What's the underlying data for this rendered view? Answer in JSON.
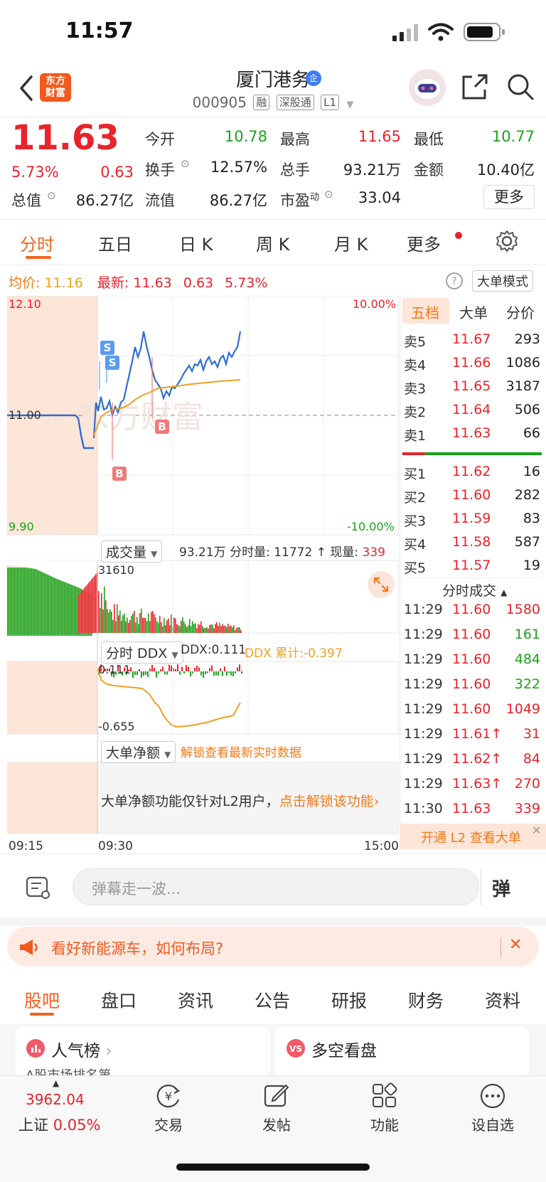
{
  "status": {
    "time": "11:57"
  },
  "header": {
    "brand_line1": "东方",
    "brand_line2": "财富",
    "stock_name": "厦门港务",
    "badge": "企",
    "code": "000905",
    "tags": [
      "融",
      "深股通",
      "L1"
    ]
  },
  "quote": {
    "price": "11.63",
    "change_pct": "5.73%",
    "change_amt": "0.63",
    "total_value_label": "总值",
    "total_value": "86.27亿",
    "open_label": "今开",
    "open": "10.78",
    "high_label": "最高",
    "high": "11.65",
    "low_label": "最低",
    "low": "10.77",
    "turnover_label": "换手",
    "turnover": "12.57%",
    "volume_label": "总手",
    "volume": "93.21万",
    "amount_label": "金额",
    "amount": "10.40亿",
    "float_label": "流值",
    "float_value": "86.27亿",
    "pe_label": "市盈",
    "pe_sup": "动",
    "pe": "33.04",
    "more_button": "更多"
  },
  "chart_tabs": [
    "分时",
    "五日",
    "日 K",
    "周 K",
    "月 K",
    "更多"
  ],
  "info_line": {
    "avg_label": "均价:",
    "avg": "11.16",
    "latest_label": "最新:",
    "latest": "11.63",
    "chg": "0.63",
    "pct": "5.73%",
    "mode_button": "大单模式"
  },
  "chart_labels": {
    "price_top": "12.10",
    "price_mid": "11.00",
    "price_bottom": "9.90",
    "pct_top": "10.00%",
    "pct_bottom": "-10.00%",
    "volume_selector": "成交量",
    "volume_total": "93.21万",
    "volume_period_label": "分时量:",
    "volume_period": "11772",
    "volume_now_label": "现量:",
    "volume_now": "339",
    "volume_axis": "31610",
    "ddx_selector": "分时 DDX",
    "ddx_text": "DDX:0.111",
    "ddx_sum": "DDX 累计:-0.397",
    "ddx_top": "0.111",
    "ddx_bottom": "-0.655",
    "bignet_selector": "大单净额",
    "bignet_unlock": "解锁查看最新实时数据",
    "bignet_notice": "大单净额功能仅针对L2用户，",
    "bignet_link": "点击解锁该功能",
    "time_start": "09:15",
    "time_open": "09:30",
    "time_end": "15:00",
    "marker_s": "S",
    "marker_b": "B"
  },
  "side_tabs": [
    "五档",
    "大单",
    "分价"
  ],
  "asks": [
    {
      "label": "卖5",
      "price": "11.67",
      "vol": "293"
    },
    {
      "label": "卖4",
      "price": "11.66",
      "vol": "1086"
    },
    {
      "label": "卖3",
      "price": "11.65",
      "vol": "3187"
    },
    {
      "label": "卖2",
      "price": "11.64",
      "vol": "506"
    },
    {
      "label": "卖1",
      "price": "11.63",
      "vol": "66"
    }
  ],
  "bids": [
    {
      "label": "买1",
      "price": "11.62",
      "vol": "16"
    },
    {
      "label": "买2",
      "price": "11.60",
      "vol": "282"
    },
    {
      "label": "买3",
      "price": "11.59",
      "vol": "83"
    },
    {
      "label": "买4",
      "price": "11.58",
      "vol": "587"
    },
    {
      "label": "买5",
      "price": "11.57",
      "vol": "19"
    }
  ],
  "ticks_title": "分时成交",
  "ticks": [
    {
      "time": "11:29",
      "price": "11.60",
      "vol": "1580",
      "vcolor": "red"
    },
    {
      "time": "11:29",
      "price": "11.60",
      "vol": "161",
      "vcolor": "green"
    },
    {
      "time": "11:29",
      "price": "11.60",
      "vol": "484",
      "vcolor": "green"
    },
    {
      "time": "11:29",
      "price": "11.60",
      "vol": "322",
      "vcolor": "green"
    },
    {
      "time": "11:29",
      "price": "11.60",
      "vol": "1049",
      "vcolor": "red"
    },
    {
      "time": "11:29",
      "price": "11.61↑",
      "vol": "31",
      "vcolor": "red"
    },
    {
      "time": "11:29",
      "price": "11.62↑",
      "vol": "84",
      "vcolor": "red"
    },
    {
      "time": "11:29",
      "price": "11.63↑",
      "vol": "270",
      "vcolor": "red"
    },
    {
      "time": "11:30",
      "price": "11.63",
      "vol": "339",
      "vcolor": "red"
    }
  ],
  "l2_link": "开通 L2 查看大单",
  "danmu": {
    "placeholder": "弹幕走一波...",
    "button": "弹"
  },
  "banner": {
    "text": "看好新能源车，如何布局?"
  },
  "bottom_tabs": [
    "股吧",
    "盘口",
    "资讯",
    "公告",
    "研报",
    "财务",
    "资料"
  ],
  "cards": {
    "left_title": "人气榜",
    "left_sub": "A股市场排名第",
    "right_title": "多空看盘"
  },
  "nav": {
    "index_value": "3962.04",
    "index_name": "上证",
    "index_pct": "0.05%",
    "items": [
      "交易",
      "发帖",
      "功能",
      "设自选"
    ]
  }
}
